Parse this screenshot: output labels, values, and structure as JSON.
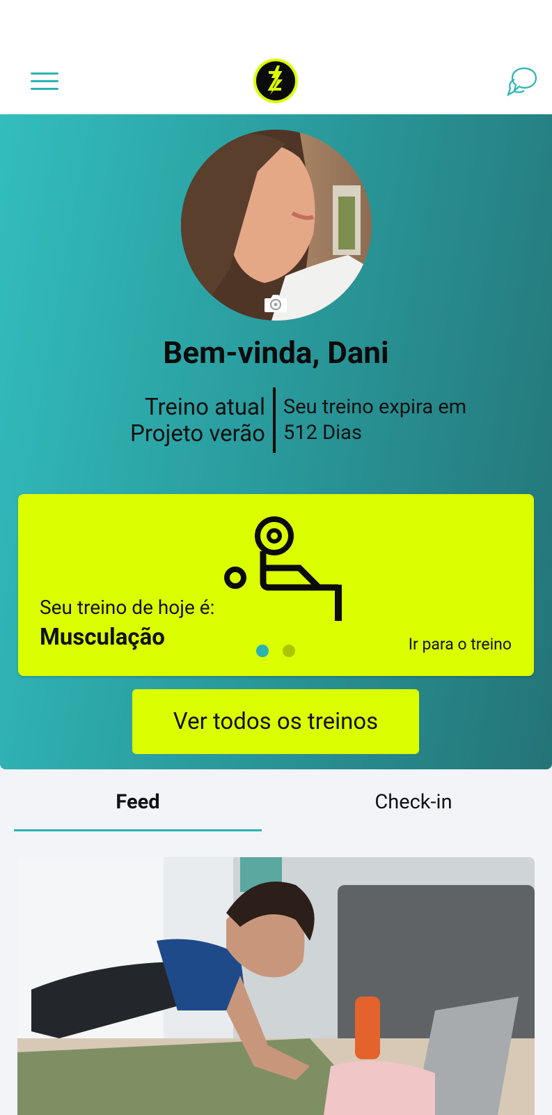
{
  "header": {
    "logo": "lightning-logo",
    "menu_icon": "hamburger-menu-icon",
    "chat_icon": "chat-bubble-icon"
  },
  "hero": {
    "welcome": "Bem-vinda, Dani",
    "current_label": "Treino atual",
    "current_value": "Projeto verão",
    "expires_label": "Seu treino expira em",
    "expires_value": "512 Dias"
  },
  "card": {
    "today_label": "Seu treino de hoje é:",
    "today_value": "Musculação",
    "go_link": "Ir para o treino",
    "icon": "weight-lifting-icon"
  },
  "actions": {
    "all_workouts": "Ver todos os treinos"
  },
  "tabs": [
    {
      "label": "Feed"
    },
    {
      "label": "Check-in"
    }
  ],
  "colors": {
    "accent": "#2bb3b3",
    "lime": "#dcff00",
    "hero_start": "#33bdbd",
    "hero_end": "#247477"
  }
}
